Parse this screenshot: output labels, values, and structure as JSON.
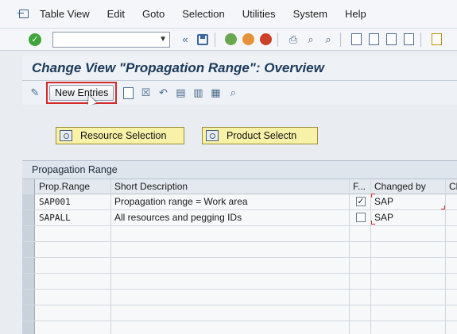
{
  "menu": {
    "items": [
      {
        "label": "Table View"
      },
      {
        "label": "Edit"
      },
      {
        "label": "Goto"
      },
      {
        "label": "Selection"
      },
      {
        "label": "Utilities"
      },
      {
        "label": "System"
      },
      {
        "label": "Help"
      }
    ]
  },
  "toolbar": {
    "command_field_value": "",
    "icons": [
      "check-icon",
      "save-icon",
      "back-icon",
      "exit-icon",
      "cancel-icon",
      "print-icon",
      "find-icon",
      "find-next-icon",
      "first-page-icon",
      "previous-page-icon",
      "next-page-icon",
      "last-page-icon",
      "new-session-icon"
    ]
  },
  "header": {
    "title": "Change View \"Propagation Range\": Overview"
  },
  "app_toolbar": {
    "new_entries_label": "New Entries",
    "icons": [
      "display-change-icon",
      "copy-as-icon",
      "delete-icon",
      "undo-icon",
      "select-all-icon",
      "select-block-icon",
      "deselect-all-icon",
      "details-icon"
    ]
  },
  "buttons": {
    "resource_selection": "Resource Selection",
    "product_selection": "Product Selectn"
  },
  "table": {
    "caption": "Propagation Range",
    "columns": [
      "Prop.Range",
      "Short Description",
      "F...",
      "Changed by",
      "Ch"
    ],
    "rows": [
      {
        "prop_range": "SAP001",
        "description": "Propagation range = Work area",
        "flag": true,
        "changed_by": "SAP"
      },
      {
        "prop_range": "SAPALL",
        "description": "All resources and pegging IDs",
        "flag": false,
        "changed_by": "SAP"
      }
    ],
    "empty_rows": 7
  },
  "colors": {
    "highlight_red": "#d42a2a",
    "selection_button_yellow": "#f7f2a8",
    "title_blue": "#1b3a5c"
  }
}
